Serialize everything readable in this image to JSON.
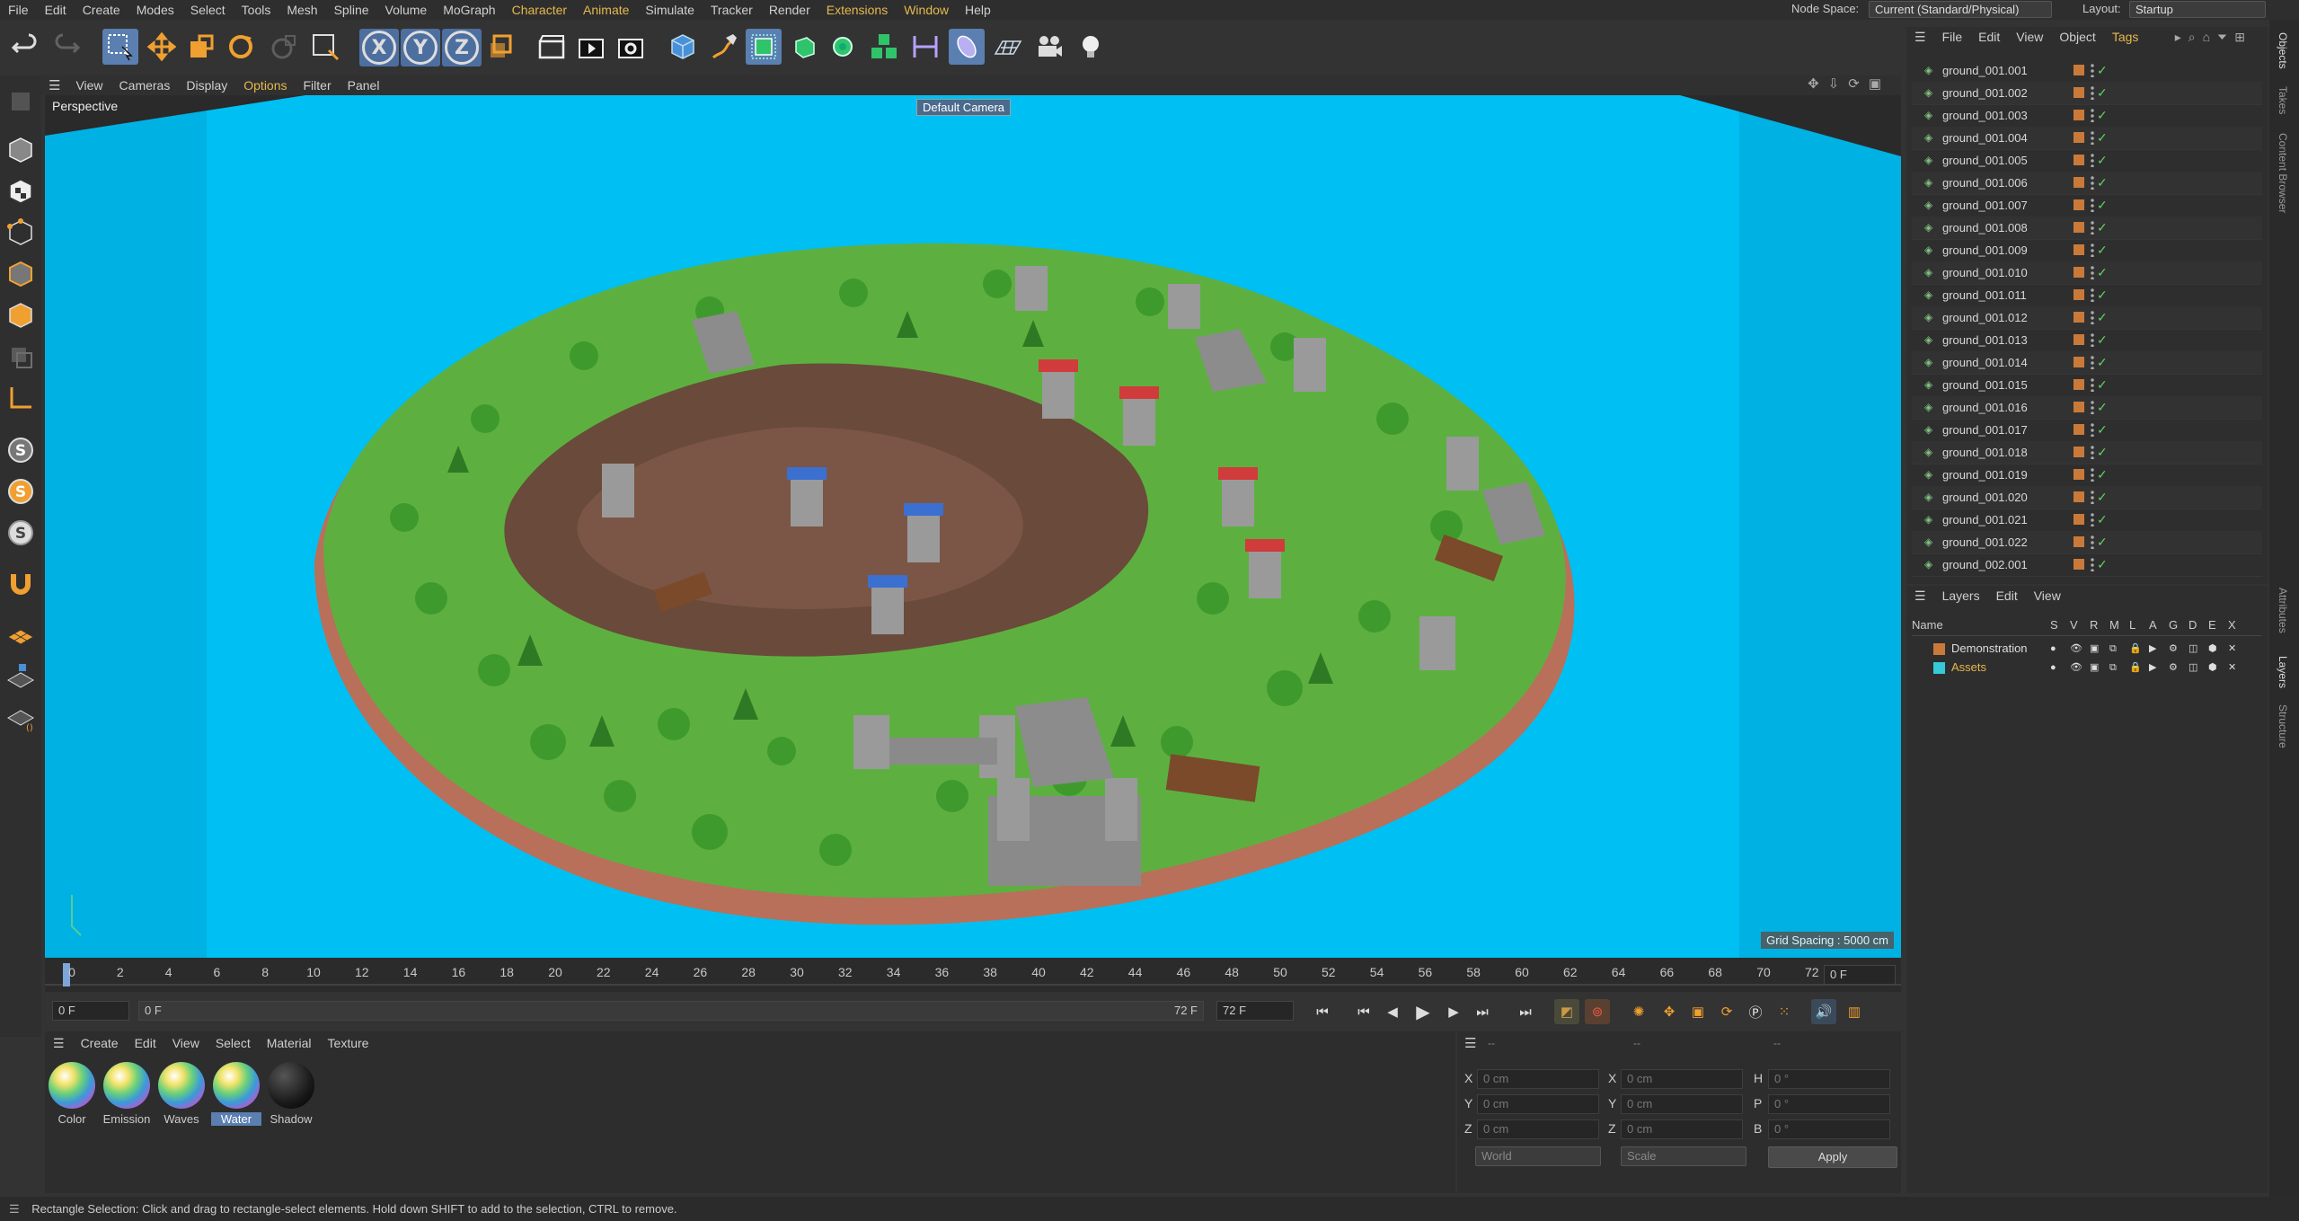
{
  "menu": [
    "File",
    "Edit",
    "Create",
    "Modes",
    "Select",
    "Tools",
    "Mesh",
    "Spline",
    "Volume",
    "MoGraph",
    "Character",
    "Animate",
    "Simulate",
    "Tracker",
    "Render",
    "Extensions",
    "Window",
    "Help"
  ],
  "node_space_label": "Node Space:",
  "node_space_value": "Current (Standard/Physical)",
  "layout_label": "Layout:",
  "layout_value": "Startup",
  "axes": [
    "X",
    "Y",
    "Z"
  ],
  "viewport_menu": [
    "View",
    "Cameras",
    "Display",
    "Options",
    "Filter",
    "Panel"
  ],
  "viewport_label": "Perspective",
  "camera_label": "Default Camera",
  "grid_spacing": "Grid Spacing : 5000 cm",
  "timeline_ticks": [
    "0",
    "2",
    "4",
    "6",
    "8",
    "10",
    "12",
    "14",
    "16",
    "18",
    "20",
    "22",
    "24",
    "26",
    "28",
    "30",
    "32",
    "34",
    "36",
    "38",
    "40",
    "42",
    "44",
    "46",
    "48",
    "50",
    "52",
    "54",
    "56",
    "58",
    "60",
    "62",
    "64",
    "66",
    "68",
    "70",
    "72"
  ],
  "current_frame_right": "0 F",
  "transport": {
    "start": "0 F",
    "range_start": "0 F",
    "range_end": "72 F",
    "end": "72 F"
  },
  "material_menu": [
    "Create",
    "Edit",
    "View",
    "Select",
    "Material",
    "Texture"
  ],
  "materials": [
    {
      "name": "Color",
      "style": "rainbow"
    },
    {
      "name": "Emission",
      "style": "rainbow"
    },
    {
      "name": "Waves",
      "style": "rainbow"
    },
    {
      "name": "Water",
      "style": "rainbow"
    },
    {
      "name": "Shadow",
      "style": "dark"
    }
  ],
  "coords": {
    "header": [
      "--",
      "--",
      "--"
    ],
    "rows": [
      {
        "a": "X",
        "av": "0 cm",
        "b": "X",
        "bv": "0 cm",
        "c": "H",
        "cv": "0 °"
      },
      {
        "a": "Y",
        "av": "0 cm",
        "b": "Y",
        "bv": "0 cm",
        "c": "P",
        "cv": "0 °"
      },
      {
        "a": "Z",
        "av": "0 cm",
        "b": "Z",
        "bv": "0 cm",
        "c": "B",
        "cv": "0 °"
      }
    ],
    "world": "World",
    "scale": "Scale",
    "apply": "Apply"
  },
  "object_menu": [
    "File",
    "Edit",
    "View",
    "Object",
    "Tags"
  ],
  "objects": [
    "ground_001.001",
    "ground_001.002",
    "ground_001.003",
    "ground_001.004",
    "ground_001.005",
    "ground_001.006",
    "ground_001.007",
    "ground_001.008",
    "ground_001.009",
    "ground_001.010",
    "ground_001.011",
    "ground_001.012",
    "ground_001.013",
    "ground_001.014",
    "ground_001.015",
    "ground_001.016",
    "ground_001.017",
    "ground_001.018",
    "ground_001.019",
    "ground_001.020",
    "ground_001.021",
    "ground_001.022",
    "ground_002.001"
  ],
  "layers_menu": [
    "Layers",
    "Edit",
    "View"
  ],
  "layers_columns": [
    "Name",
    "S",
    "V",
    "R",
    "M",
    "L",
    "A",
    "G",
    "D",
    "E",
    "X"
  ],
  "layers": [
    {
      "name": "Demonstration",
      "color": "#c97a3a",
      "highlight": false
    },
    {
      "name": "Assets",
      "color": "#35c9d9",
      "highlight": true
    }
  ],
  "right_tabs_top": [
    "Objects",
    "Takes",
    "Content Browser"
  ],
  "right_tabs_bottom": [
    "Attributes",
    "Layers",
    "Structure"
  ],
  "status": "Rectangle Selection: Click and drag to rectangle-select elements. Hold down SHIFT to add to the selection, CTRL to remove.",
  "colors": {
    "accent": "#5a7fb0",
    "viewport_bg": "#00bff2",
    "highlight_menu": "#e6b84c"
  }
}
